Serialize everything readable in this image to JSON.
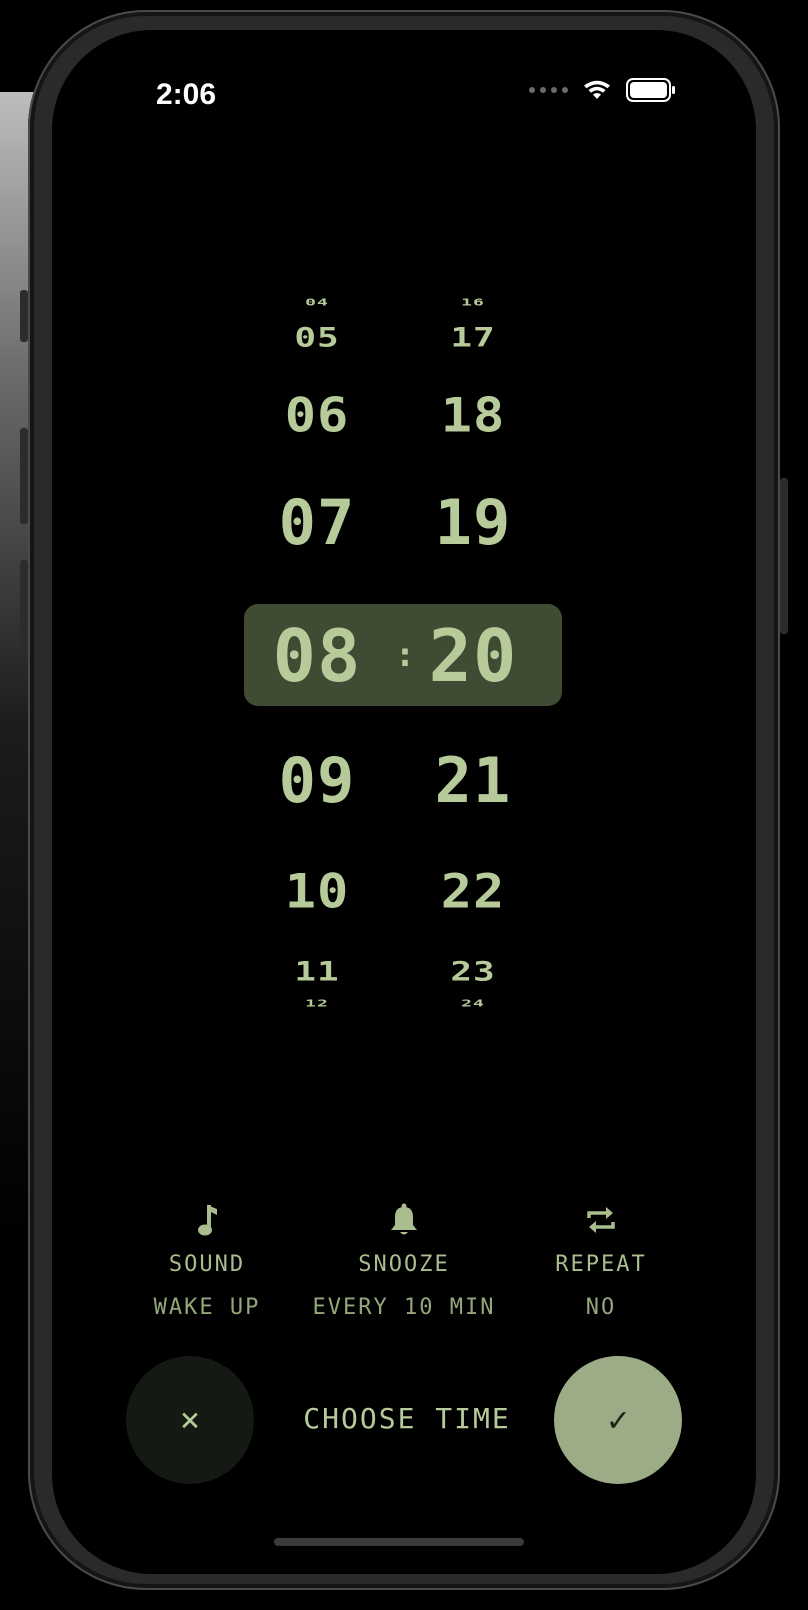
{
  "status_bar": {
    "time": "2:06"
  },
  "picker": {
    "hours": [
      "04",
      "05",
      "06",
      "07",
      "08",
      "09",
      "10",
      "11",
      "12"
    ],
    "minutes": [
      "16",
      "17",
      "18",
      "19",
      "20",
      "21",
      "22",
      "23",
      "24"
    ],
    "selected_hour": "08",
    "selected_minute": "20",
    "separator": ":"
  },
  "options": {
    "sound": {
      "title": "SOUND",
      "value": "WAKE UP",
      "icon": "music-note-icon"
    },
    "snooze": {
      "title": "SNOOZE",
      "value": "EVERY 10 MIN",
      "icon": "bell-icon"
    },
    "repeat": {
      "title": "REPEAT",
      "value": "NO",
      "icon": "repeat-icon"
    }
  },
  "actions": {
    "cancel_icon": "×",
    "confirm_icon": "✓",
    "choose_label": "CHOOSE TIME"
  },
  "colors": {
    "accent": "#b7cb9a",
    "selected_bg": "#3f4b32",
    "confirm_bg": "#9cac87"
  }
}
